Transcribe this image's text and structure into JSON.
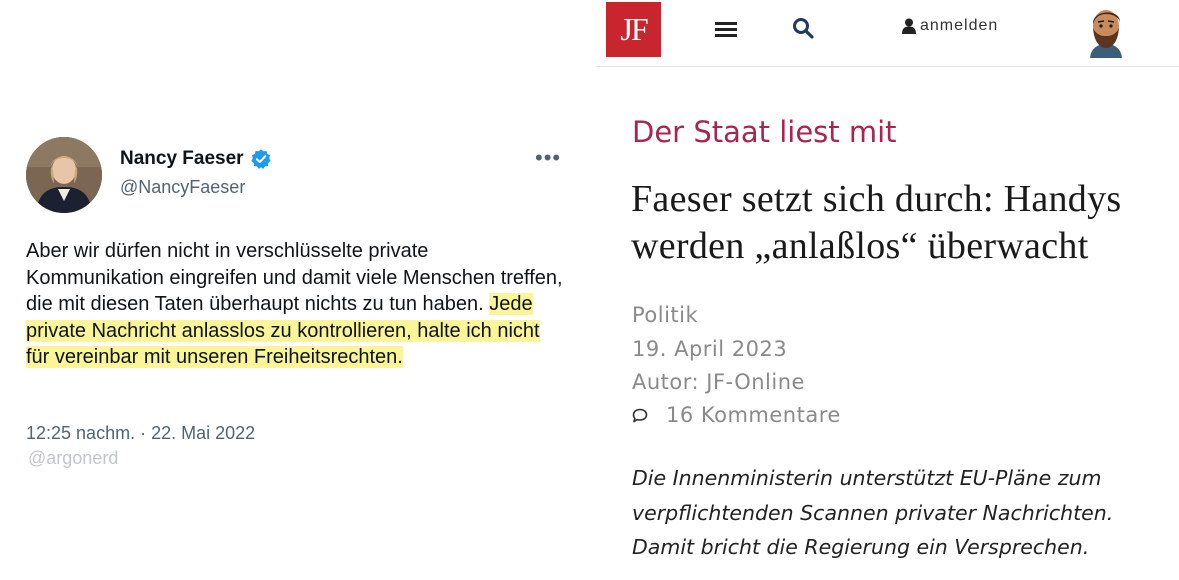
{
  "tweet": {
    "author_name": "Nancy Faeser",
    "author_handle": "@NancyFaeser",
    "text_plain": "Aber wir dürfen nicht in verschlüsselte private Kommunikation eingreifen und damit viele Menschen treffen, die mit diesen Taten überhaupt nichts zu tun haben. ",
    "text_highlighted": "Jede private Nachricht anlasslos zu kontrollieren, halte ich nicht für vereinbar mit unseren Freiheitsrechten.",
    "timestamp": "12:25 nachm. · 22. Mai 2022",
    "watermark": "@argonerd",
    "highlight_color": "#fbf59a",
    "verified_color": "#1d9bf0"
  },
  "article": {
    "header": {
      "logo": "JF",
      "login_label": "anmelden",
      "icons": [
        "menu-icon",
        "search-icon",
        "user-icon"
      ],
      "logo_color": "#c8252e"
    },
    "kicker": "Der Staat liest mit",
    "headline": "Faeser setzt sich durch: Handys werden „anlaßlos“ überwacht",
    "category": "Politik",
    "date": "19. April 2023",
    "author": "Autor: JF-Online",
    "comments": "16 Kommentare",
    "teaser": "Die Innenministerin unterstützt EU-Pläne zum verpflichtenden Scannen privater Nachrichten. Damit bricht die Regierung ein Versprechen.",
    "kicker_color": "#a8264c"
  }
}
